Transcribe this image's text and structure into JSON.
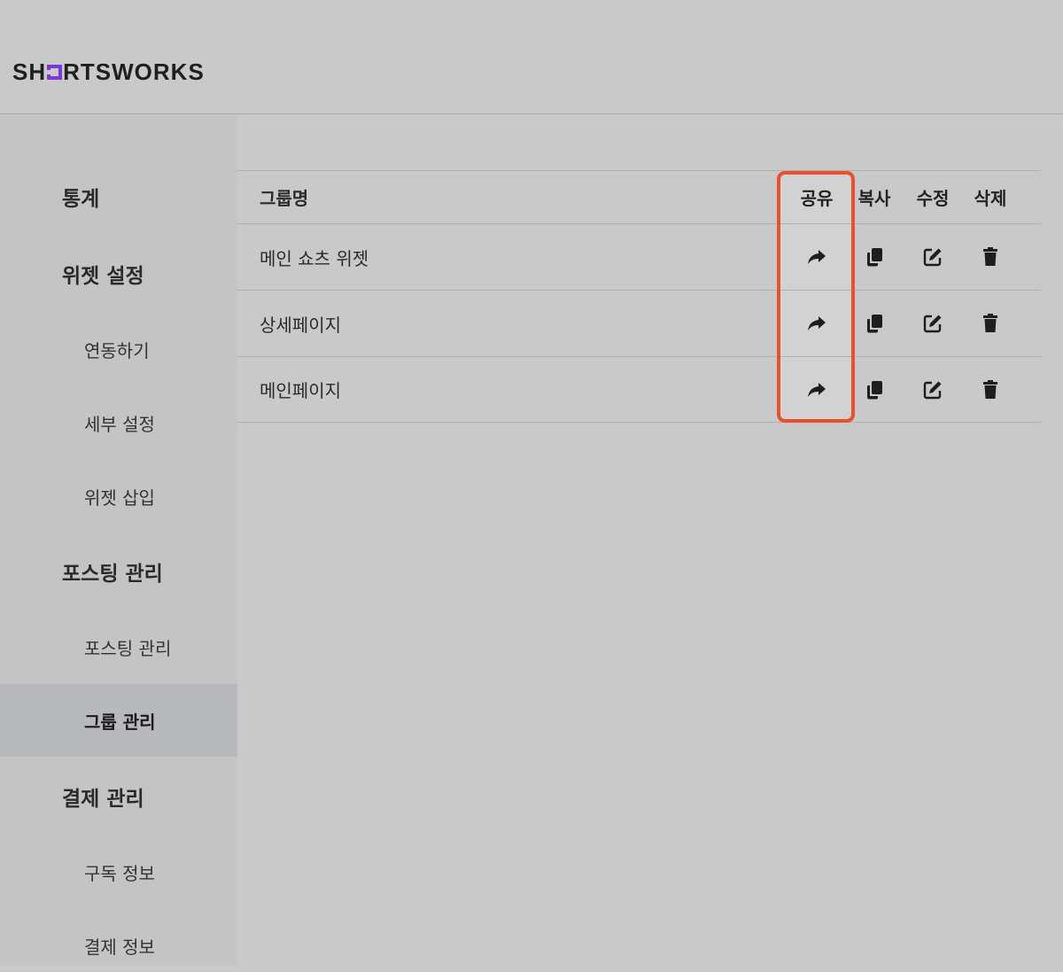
{
  "brand": {
    "logo_prefix": "SH",
    "logo_suffix": "RTSWORKS",
    "accent": "#7a3ad1"
  },
  "sidebar": {
    "items": [
      {
        "label": "통계",
        "level": "top"
      },
      {
        "label": "위젯 설정",
        "level": "top"
      },
      {
        "label": "연동하기",
        "level": "sub"
      },
      {
        "label": "세부 설정",
        "level": "sub"
      },
      {
        "label": "위젯 삽입",
        "level": "sub"
      },
      {
        "label": "포스팅 관리",
        "level": "top"
      },
      {
        "label": "포스팅 관리",
        "level": "sub"
      },
      {
        "label": "그룹 관리",
        "level": "sub",
        "active": true
      },
      {
        "label": "결제 관리",
        "level": "top"
      },
      {
        "label": "구독 정보",
        "level": "sub"
      },
      {
        "label": "결제 정보",
        "level": "sub"
      }
    ]
  },
  "table": {
    "headers": {
      "name": "그룹명",
      "share": "공유",
      "copy": "복사",
      "edit": "수정",
      "delete": "삭제"
    },
    "rows": [
      {
        "name": "메인 쇼츠 위젯"
      },
      {
        "name": "상세페이지"
      },
      {
        "name": "메인페이지"
      }
    ]
  },
  "icons": {
    "share": "share-arrow-icon",
    "copy": "copy-icon",
    "edit": "edit-icon",
    "delete": "trash-icon"
  },
  "highlight_color": "#e8502e"
}
